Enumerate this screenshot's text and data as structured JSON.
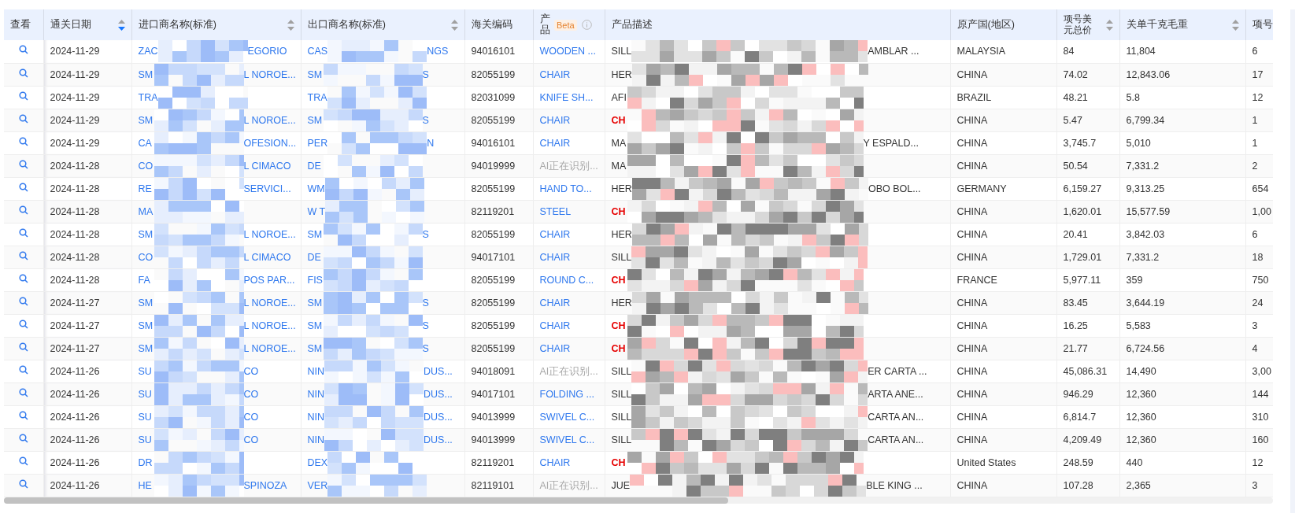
{
  "table": {
    "columns": [
      {
        "label": "查看"
      },
      {
        "label": "通关日期",
        "sortable": true,
        "sort_desc": true
      },
      {
        "label": "进口商名称(标准)",
        "sortable": true,
        "sort_desc": false
      },
      {
        "label": "出口商名称(标准)",
        "sortable": true,
        "sort_desc": false
      },
      {
        "label": "海关编码"
      },
      {
        "label": "产品",
        "badge": "Beta",
        "info": true
      },
      {
        "label": "产品描述"
      },
      {
        "label": "原产国(地区)"
      },
      {
        "label": "项号美元总价",
        "sortable": true,
        "sort_desc": false
      },
      {
        "label": "关单千克毛重",
        "sortable": true,
        "sort_desc": false
      },
      {
        "label": "项号"
      }
    ],
    "rows": [
      {
        "date": "2024-11-29",
        "importer": {
          "lead": "ZAC",
          "tail": "EGORIO"
        },
        "exporter": {
          "lead": "CAS",
          "tail": "NGS"
        },
        "hs_code": "94016101",
        "product": {
          "text": "WOODEN ...",
          "kind": "name"
        },
        "description": {
          "lead": "SILL",
          "tail": "AMBLAR ...",
          "flagged": false
        },
        "origin": "MALAYSIA",
        "value_usd": "84",
        "gross_kg": "11,804",
        "item_no": "6"
      },
      {
        "date": "2024-11-29",
        "importer": {
          "lead": "SM",
          "tail": "L NOROE..."
        },
        "exporter": {
          "lead": "SM",
          "tail": "S"
        },
        "hs_code": "82055199",
        "product": {
          "text": "CHAIR",
          "kind": "name"
        },
        "description": {
          "lead": "HER",
          "flagged": false
        },
        "origin": "CHINA",
        "value_usd": "74.02",
        "gross_kg": "12,843.06",
        "item_no": "17"
      },
      {
        "date": "2024-11-29",
        "importer": {
          "lead": "TRA"
        },
        "exporter": {
          "lead": "TRA"
        },
        "hs_code": "82031099",
        "product": {
          "text": "KNIFE SH...",
          "kind": "name"
        },
        "description": {
          "lead": "AFI",
          "flagged": false
        },
        "origin": "BRAZIL",
        "value_usd": "48.21",
        "gross_kg": "5.8",
        "item_no": "12"
      },
      {
        "date": "2024-11-29",
        "importer": {
          "lead": "SM",
          "tail": "L NOROE..."
        },
        "exporter": {
          "lead": "SM",
          "tail": "S"
        },
        "hs_code": "82055199",
        "product": {
          "text": "CHAIR",
          "kind": "name"
        },
        "description": {
          "lead": "CH",
          "flagged": true
        },
        "origin": "CHINA",
        "value_usd": "5.47",
        "gross_kg": "6,799.34",
        "item_no": "1"
      },
      {
        "date": "2024-11-29",
        "importer": {
          "lead": "CA",
          "tail": "OFESION..."
        },
        "exporter": {
          "lead": "PER",
          "tail": "N"
        },
        "hs_code": "94016101",
        "product": {
          "text": "CHAIR",
          "kind": "name"
        },
        "description": {
          "lead": "MA",
          "tail": "Y ESPALD...",
          "flagged": false
        },
        "origin": "CHINA",
        "value_usd": "3,745.7",
        "gross_kg": "5,010",
        "item_no": "1"
      },
      {
        "date": "2024-11-28",
        "importer": {
          "lead": "CO",
          "tail": "L CIMACO"
        },
        "exporter": {
          "lead": "DE"
        },
        "hs_code": "94019999",
        "product": {
          "text": "AI正在识别...",
          "kind": "pending"
        },
        "description": {
          "lead": "MA",
          "flagged": false
        },
        "origin": "CHINA",
        "value_usd": "50.54",
        "gross_kg": "7,331.2",
        "item_no": "2"
      },
      {
        "date": "2024-11-28",
        "importer": {
          "lead": "RE",
          "tail": "SERVICI..."
        },
        "exporter": {
          "lead": "WM"
        },
        "hs_code": "82055199",
        "product": {
          "text": "HAND TO...",
          "kind": "name"
        },
        "description": {
          "lead": "HER",
          "tail": "OBO BOL...",
          "flagged": false
        },
        "origin": "GERMANY",
        "value_usd": "6,159.27",
        "gross_kg": "9,313.25",
        "item_no": "654"
      },
      {
        "date": "2024-11-28",
        "importer": {
          "lead": "MA"
        },
        "exporter": {
          "lead": "W T"
        },
        "hs_code": "82119201",
        "product": {
          "text": "STEEL",
          "kind": "name"
        },
        "description": {
          "lead": "CH",
          "flagged": true
        },
        "origin": "CHINA",
        "value_usd": "1,620.01",
        "gross_kg": "15,577.59",
        "item_no": "1,00"
      },
      {
        "date": "2024-11-28",
        "importer": {
          "lead": "SM",
          "tail": "L NOROE..."
        },
        "exporter": {
          "lead": "SM",
          "tail": "S"
        },
        "hs_code": "82055199",
        "product": {
          "text": "CHAIR",
          "kind": "name"
        },
        "description": {
          "lead": "HER",
          "flagged": false
        },
        "origin": "CHINA",
        "value_usd": "20.41",
        "gross_kg": "3,842.03",
        "item_no": "6"
      },
      {
        "date": "2024-11-28",
        "importer": {
          "lead": "CO",
          "tail": "L CIMACO"
        },
        "exporter": {
          "lead": "DE"
        },
        "hs_code": "94017101",
        "product": {
          "text": "CHAIR",
          "kind": "name"
        },
        "description": {
          "lead": "SILL",
          "flagged": false
        },
        "origin": "CHINA",
        "value_usd": "1,729.01",
        "gross_kg": "7,331.2",
        "item_no": "18"
      },
      {
        "date": "2024-11-28",
        "importer": {
          "lead": "FA",
          "tail": "POS PAR..."
        },
        "exporter": {
          "lead": "FIS"
        },
        "hs_code": "82055199",
        "product": {
          "text": "ROUND C...",
          "kind": "name"
        },
        "description": {
          "lead": "CH",
          "flagged": true
        },
        "origin": "FRANCE",
        "value_usd": "5,977.11",
        "gross_kg": "359",
        "item_no": "750"
      },
      {
        "date": "2024-11-27",
        "importer": {
          "lead": "SM",
          "tail": "L NOROE..."
        },
        "exporter": {
          "lead": "SM",
          "tail": "S"
        },
        "hs_code": "82055199",
        "product": {
          "text": "CHAIR",
          "kind": "name"
        },
        "description": {
          "lead": "HER",
          "flagged": false
        },
        "origin": "CHINA",
        "value_usd": "83.45",
        "gross_kg": "3,644.19",
        "item_no": "24"
      },
      {
        "date": "2024-11-27",
        "importer": {
          "lead": "SM",
          "tail": "L NOROE..."
        },
        "exporter": {
          "lead": "SM",
          "tail": "S"
        },
        "hs_code": "82055199",
        "product": {
          "text": "CHAIR",
          "kind": "name"
        },
        "description": {
          "lead": "CH",
          "flagged": true
        },
        "origin": "CHINA",
        "value_usd": "16.25",
        "gross_kg": "5,583",
        "item_no": "3"
      },
      {
        "date": "2024-11-27",
        "importer": {
          "lead": "SM",
          "tail": "L NOROE..."
        },
        "exporter": {
          "lead": "SM",
          "tail": "S"
        },
        "hs_code": "82055199",
        "product": {
          "text": "CHAIR",
          "kind": "name"
        },
        "description": {
          "lead": "CH",
          "flagged": true
        },
        "origin": "CHINA",
        "value_usd": "21.77",
        "gross_kg": "6,724.56",
        "item_no": "4"
      },
      {
        "date": "2024-11-26",
        "importer": {
          "lead": "SU",
          "tail": "CO"
        },
        "exporter": {
          "lead": "NIN",
          "tail": "DUS..."
        },
        "hs_code": "94018091",
        "product": {
          "text": "AI正在识别...",
          "kind": "pending"
        },
        "description": {
          "lead": "SILL",
          "tail": "ER CARTA ...",
          "flagged": false
        },
        "origin": "CHINA",
        "value_usd": "45,086.31",
        "gross_kg": "14,490",
        "item_no": "3,00"
      },
      {
        "date": "2024-11-26",
        "importer": {
          "lead": "SU",
          "tail": "CO"
        },
        "exporter": {
          "lead": "NIN",
          "tail": "DUS..."
        },
        "hs_code": "94017101",
        "product": {
          "text": "FOLDING ...",
          "kind": "name"
        },
        "description": {
          "lead": "SILL",
          "tail": "ARTA ANE...",
          "flagged": false
        },
        "origin": "CHINA",
        "value_usd": "946.29",
        "gross_kg": "12,360",
        "item_no": "144"
      },
      {
        "date": "2024-11-26",
        "importer": {
          "lead": "SU",
          "tail": "CO"
        },
        "exporter": {
          "lead": "NIN",
          "tail": "DUS..."
        },
        "hs_code": "94013999",
        "product": {
          "text": "SWIVEL C...",
          "kind": "name"
        },
        "description": {
          "lead": "SILL",
          "tail": "CARTA AN...",
          "flagged": false
        },
        "origin": "CHINA",
        "value_usd": "6,814.7",
        "gross_kg": "12,360",
        "item_no": "310"
      },
      {
        "date": "2024-11-26",
        "importer": {
          "lead": "SU",
          "tail": "CO"
        },
        "exporter": {
          "lead": "NIN",
          "tail": "DUS..."
        },
        "hs_code": "94013999",
        "product": {
          "text": "SWIVEL C...",
          "kind": "name"
        },
        "description": {
          "lead": "SILL",
          "tail": "CARTA AN...",
          "flagged": false
        },
        "origin": "CHINA",
        "value_usd": "4,209.49",
        "gross_kg": "12,360",
        "item_no": "160"
      },
      {
        "date": "2024-11-26",
        "importer": {
          "lead": "DR"
        },
        "exporter": {
          "lead": "DEX"
        },
        "hs_code": "82119201",
        "product": {
          "text": "CHAIR",
          "kind": "name"
        },
        "description": {
          "lead": "CH",
          "flagged": true
        },
        "origin": "United States",
        "value_usd": "248.59",
        "gross_kg": "440",
        "item_no": "12"
      },
      {
        "date": "2024-11-26",
        "importer": {
          "lead": "HE",
          "tail": "SPINOZA"
        },
        "exporter": {
          "lead": "VER"
        },
        "hs_code": "82119101",
        "product": {
          "text": "AI正在识别...",
          "kind": "pending"
        },
        "description": {
          "lead": "JUE",
          "tail": "BLE KING ...",
          "flagged": false
        },
        "origin": "CHINA",
        "value_usd": "107.28",
        "gross_kg": "2,365",
        "item_no": "3"
      }
    ]
  }
}
